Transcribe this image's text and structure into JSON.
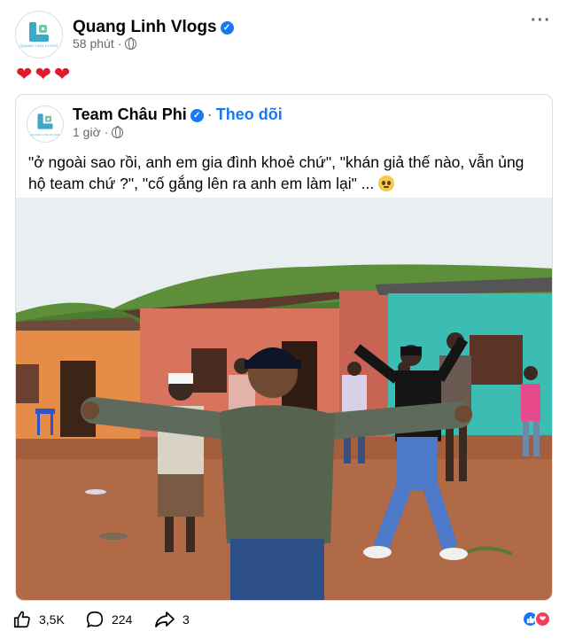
{
  "post": {
    "author": "Quang Linh Vlogs",
    "time": "58 phút",
    "text_emoji": "❤️❤️❤️",
    "logo_text": "QUANG LINH VLOGS"
  },
  "shared": {
    "author": "Team Châu Phi",
    "follow_label": "Theo dõi",
    "time": "1 giờ",
    "caption": "\"ở ngoài sao rồi, anh em gia đình khoẻ chứ\", \"khán giả thế nào, vẫn ủng hộ team chứ ?\", \"cố gắng lên ra anh em làm lại\" ...",
    "logo_text": "QUANG LINH VLOGS"
  },
  "video": {
    "description": "A man in a green hoodie and black cap with arms outstretched, dancing with a group of people in front of colorful houses in a dirt village yard."
  },
  "footer": {
    "likes": "3,5K",
    "comments": "224",
    "shares": "3"
  },
  "colors": {
    "facebook_blue": "#1877f2",
    "meta_gray": "#65676b",
    "love_red": "#f33e58"
  },
  "icons": [
    "verified-badge-icon",
    "globe-icon",
    "more-options-icon",
    "like-icon",
    "comment-icon",
    "share-icon",
    "like-reaction-icon",
    "love-reaction-icon"
  ]
}
